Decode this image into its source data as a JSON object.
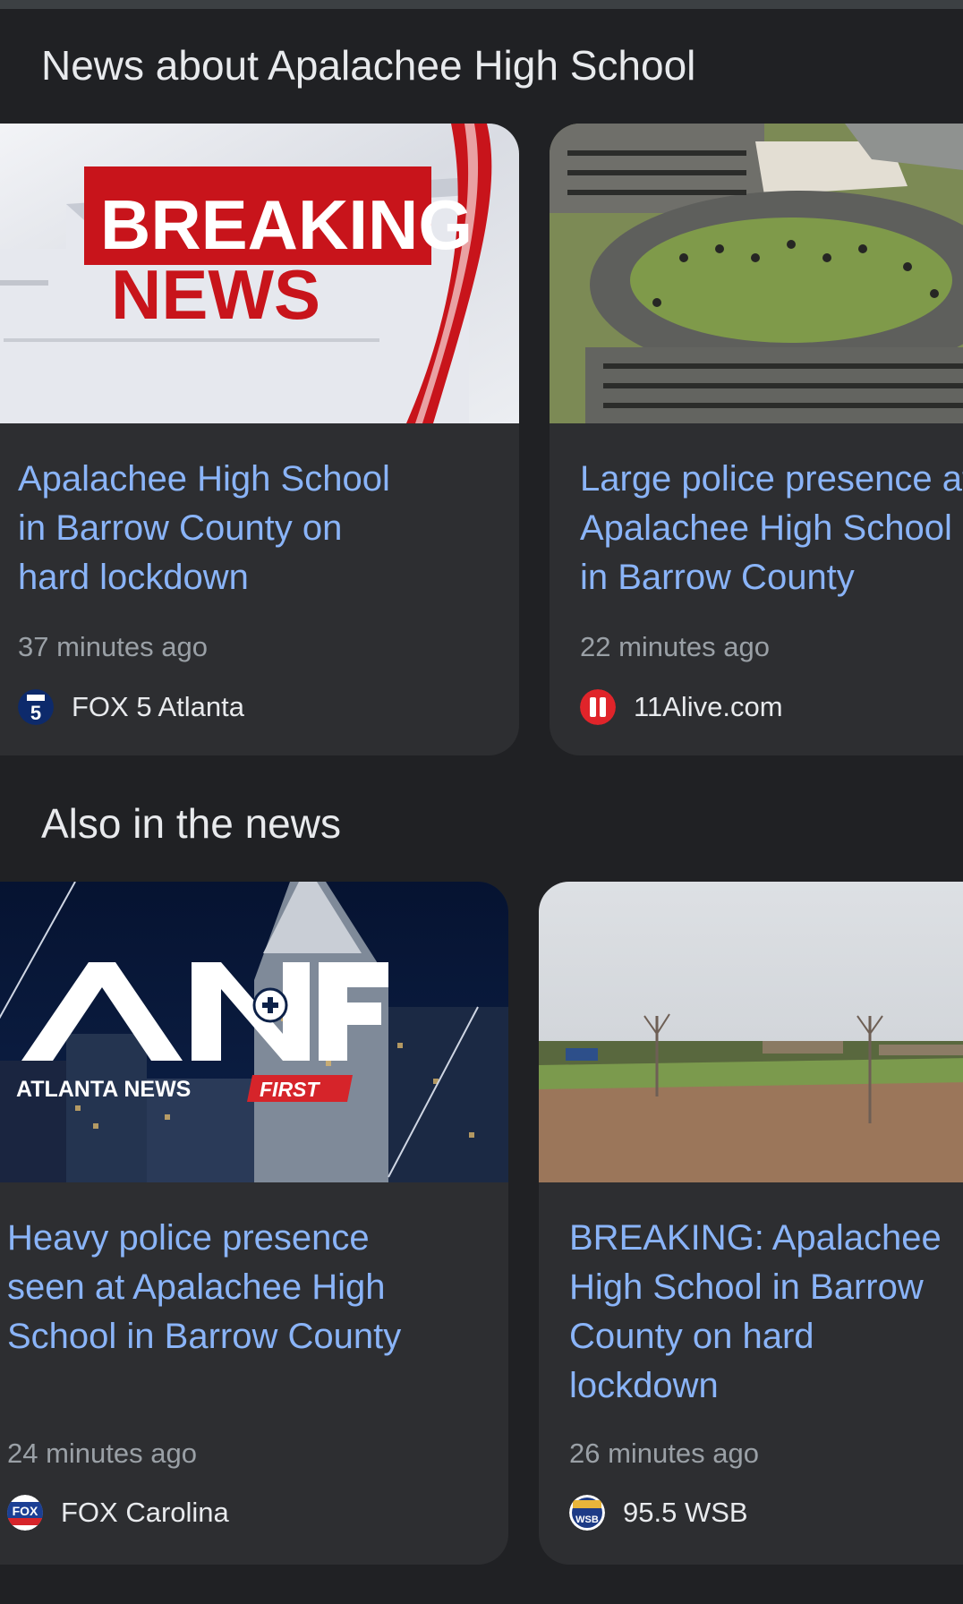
{
  "sections": {
    "top_stories": {
      "title": "News about Apalachee High School",
      "cards": [
        {
          "thumbnail": {
            "icon": "breaking-news-graphic",
            "text_line1": "BREAKING",
            "text_line2": "NEWS"
          },
          "headline": [
            "Apalachee High School",
            "in Barrow County on",
            "hard lockdown"
          ],
          "time": "37 minutes ago",
          "source": {
            "icon": "fox5-logo",
            "logo_text": "5",
            "name": "FOX 5 Atlanta"
          }
        },
        {
          "thumbnail": {
            "icon": "aerial-school-photo"
          },
          "headline": [
            "Large police presence at",
            "Apalachee High School",
            "in Barrow County"
          ],
          "time": "22 minutes ago",
          "source": {
            "icon": "11alive-logo",
            "name": "11Alive.com"
          }
        }
      ]
    },
    "also_in_news": {
      "title": "Also in the news",
      "cards": [
        {
          "thumbnail": {
            "icon": "atlanta-news-first-logo",
            "brand": "ATLANTA NEWS",
            "brand_highlight": "FIRST"
          },
          "headline": [
            "Heavy police presence",
            "seen at Apalachee High",
            "School in Barrow County"
          ],
          "time": "24 minutes ago",
          "source": {
            "icon": "fox-carolina-logo",
            "logo_text": "FOX",
            "name": "FOX Carolina"
          }
        },
        {
          "thumbnail": {
            "icon": "school-field-photo"
          },
          "headline": [
            "BREAKING: Apalachee",
            "High School in Barrow",
            "County on hard",
            "lockdown"
          ],
          "time": "26 minutes ago",
          "source": {
            "icon": "wsb-logo",
            "logo_text": "WSB",
            "name": "95.5 WSB"
          }
        }
      ]
    }
  },
  "colors": {
    "background": "#202124",
    "card": "#2d2e31",
    "headline": "#8ab4f8",
    "meta": "#9aa0a6",
    "text": "#e8eaed"
  }
}
